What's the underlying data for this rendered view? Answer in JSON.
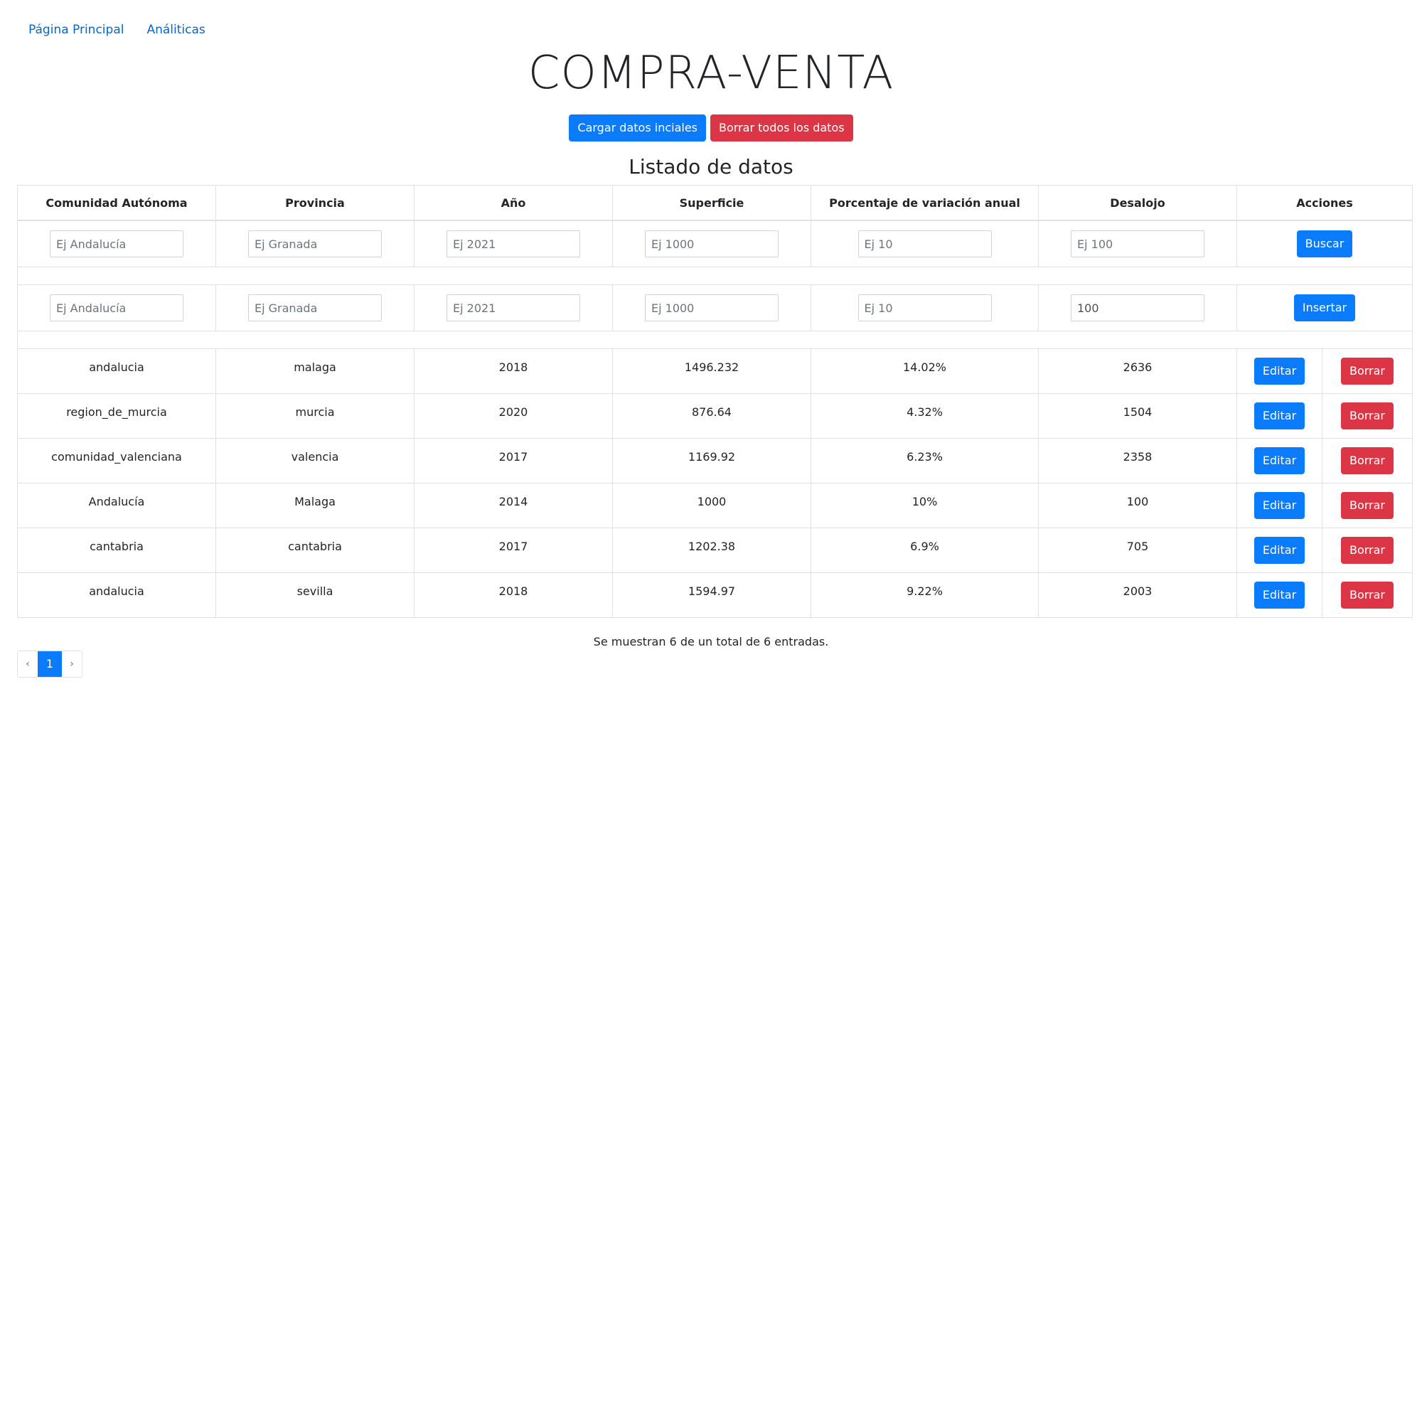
{
  "nav": {
    "home_label": "Página Principal",
    "analytics_label": "Análiticas"
  },
  "page_title": "COMPRA-VENTA",
  "actions": {
    "load_label": "Cargar datos inciales",
    "delete_all_label": "Borrar todos los datos"
  },
  "list_title": "Listado de datos",
  "table": {
    "headers": [
      "Comunidad Autónoma",
      "Provincia",
      "Año",
      "Superficie",
      "Porcentaje de variación anual",
      "Desalojo",
      "Acciones"
    ],
    "search": {
      "placeholders": [
        "Ej Andalucía",
        "Ej Granada",
        "Ej 2021",
        "Ej 1000",
        "Ej 10",
        "Ej 100"
      ],
      "button_label": "Buscar"
    },
    "insert": {
      "placeholders": [
        "Ej Andalucía",
        "Ej Granada",
        "Ej 2021",
        "Ej 1000",
        "Ej 10"
      ],
      "desalojo_value": "100",
      "button_label": "Insertar"
    },
    "edit_label": "Editar",
    "delete_label": "Borrar",
    "rows": [
      [
        "andalucia",
        "malaga",
        "2018",
        "1496.232",
        "14.02%",
        "2636"
      ],
      [
        "region_de_murcia",
        "murcia",
        "2020",
        "876.64",
        "4.32%",
        "1504"
      ],
      [
        "comunidad_valenciana",
        "valencia",
        "2017",
        "1169.92",
        "6.23%",
        "2358"
      ],
      [
        "Andalucía",
        "Malaga",
        "2014",
        "1000",
        "10%",
        "100"
      ],
      [
        "cantabria",
        "cantabria",
        "2017",
        "1202.38",
        "6.9%",
        "705"
      ],
      [
        "andalucia",
        "sevilla",
        "2018",
        "1594.97",
        "9.22%",
        "2003"
      ]
    ]
  },
  "summary": "Se muestran 6 de un total de 6 entradas.",
  "pagination": {
    "prev": "‹",
    "current": "1",
    "next": "›"
  },
  "colors": {
    "primary": "#0a7cfb",
    "danger": "#dc3545",
    "link": "#0b64c8"
  }
}
